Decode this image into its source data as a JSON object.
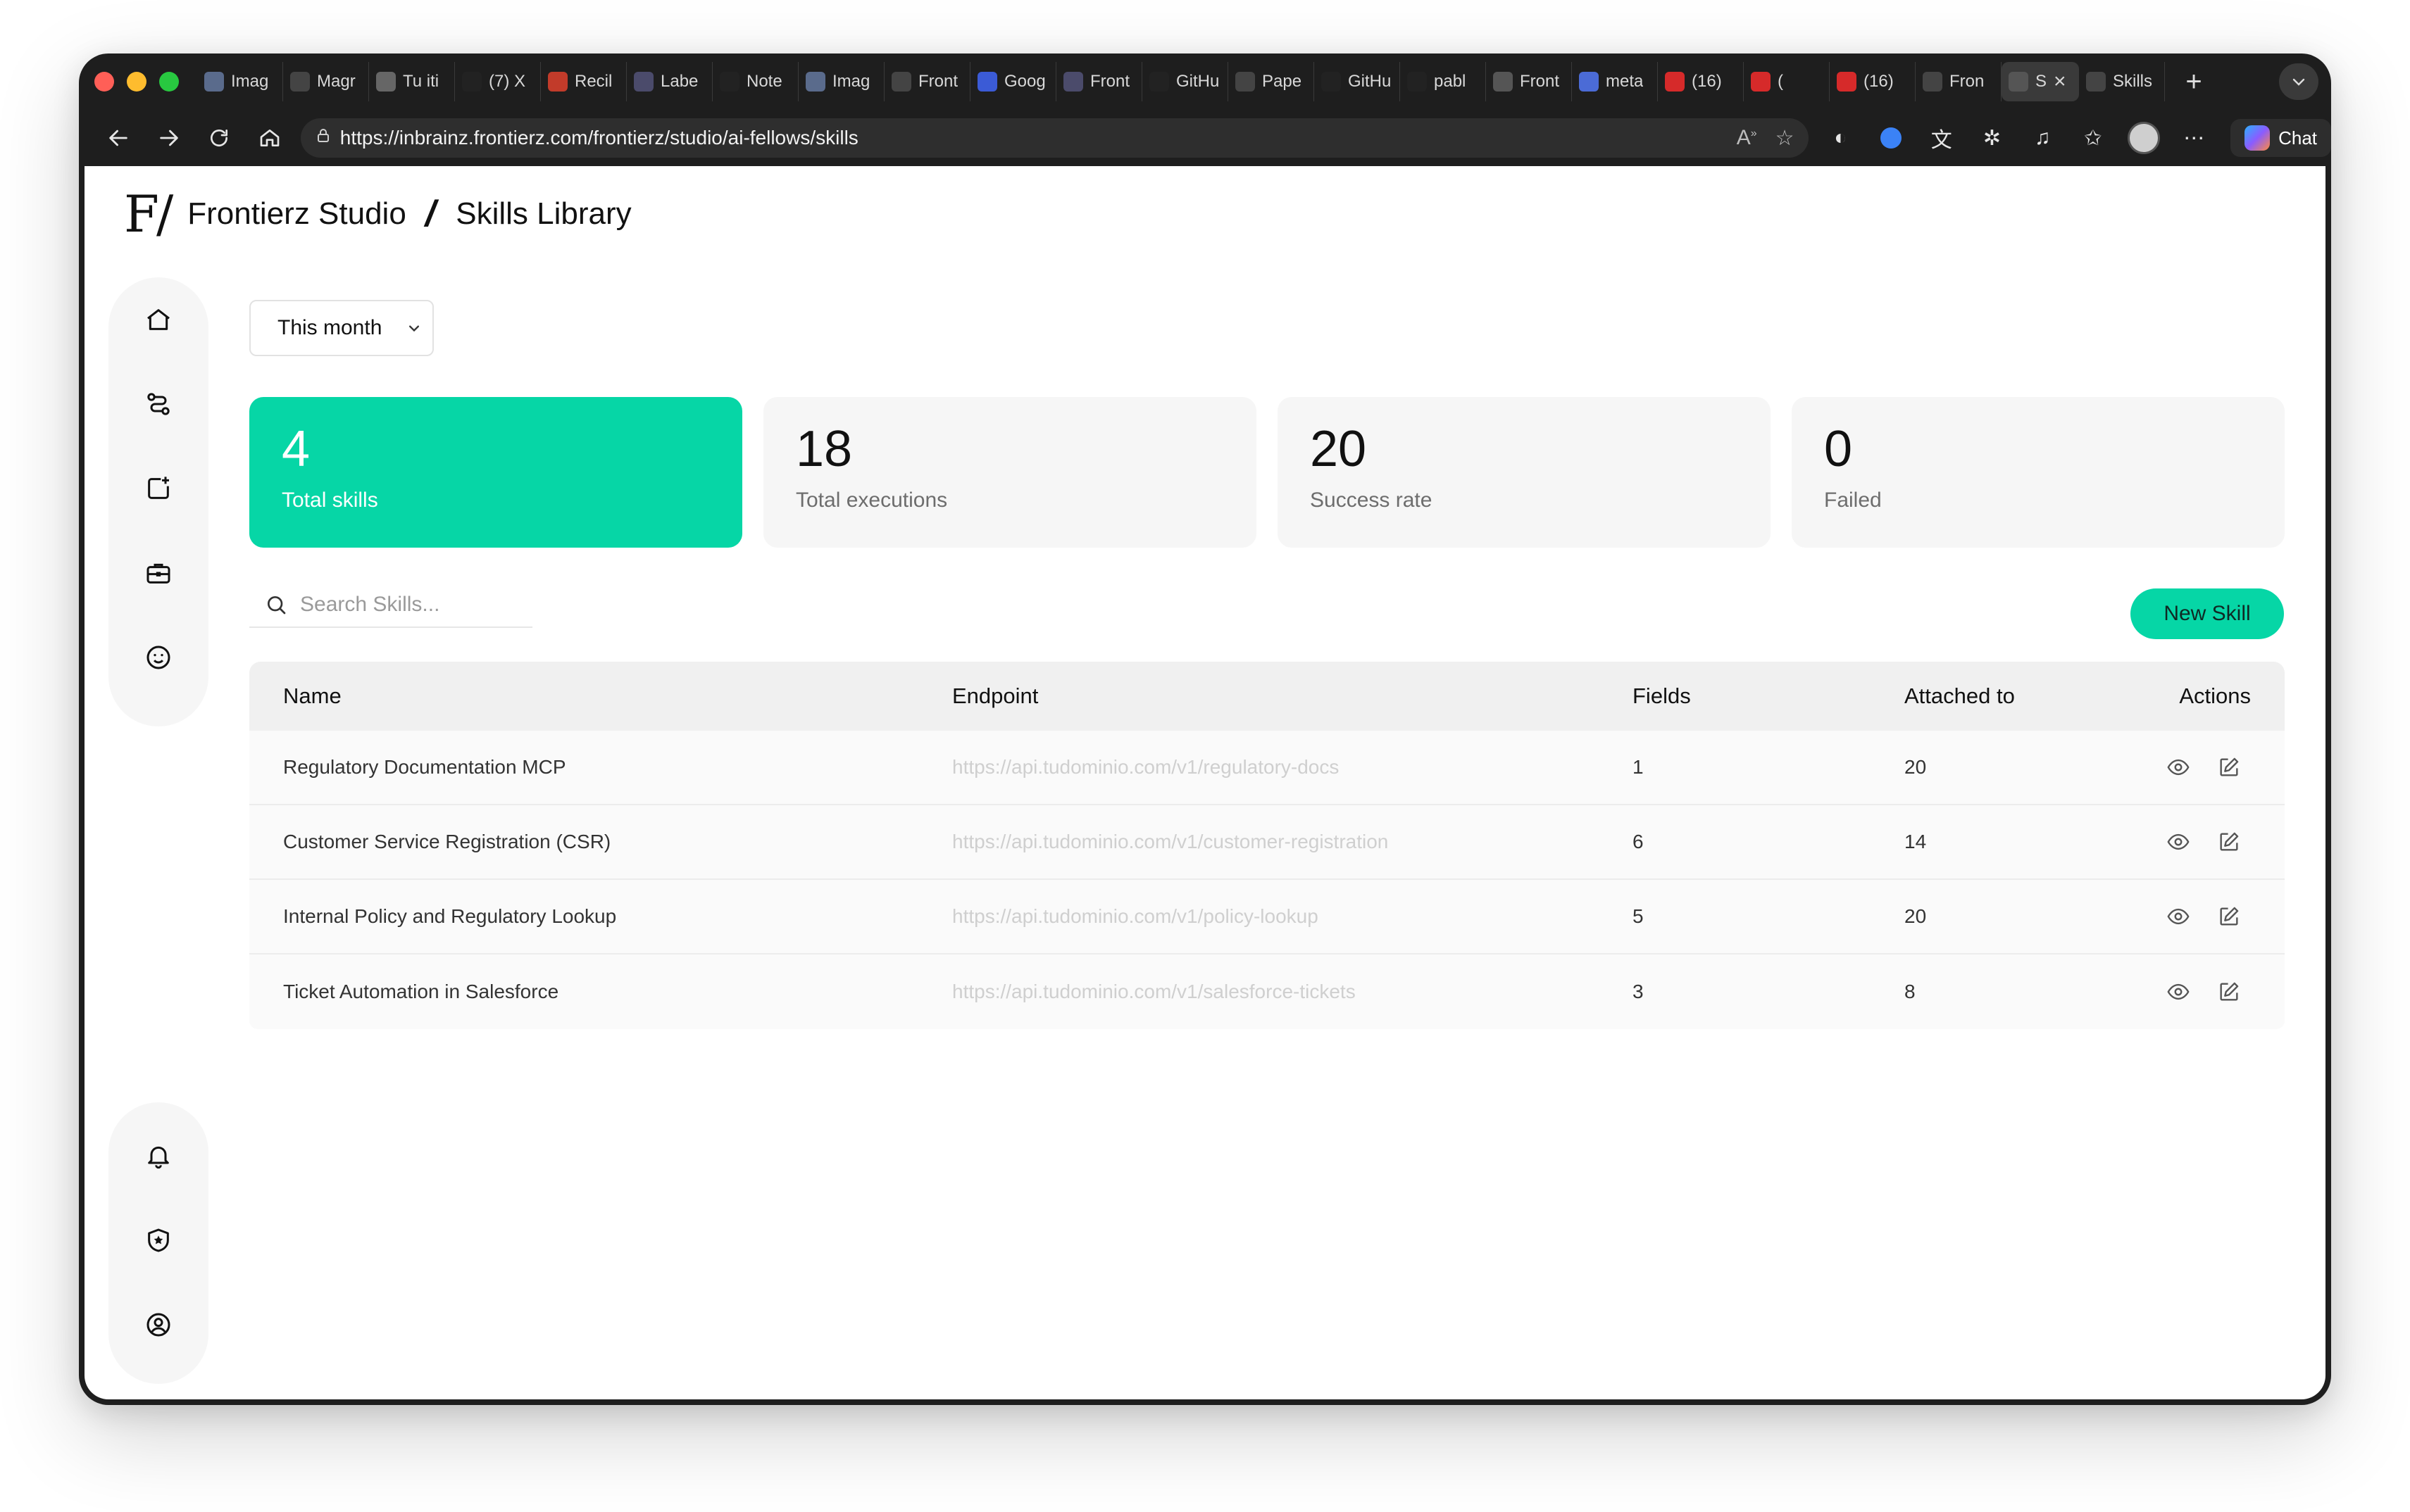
{
  "browser": {
    "tabs": [
      {
        "label": "Imag",
        "icon": "doc-icon",
        "color": "#5a6b8c"
      },
      {
        "label": "Magr",
        "icon": "triangle-icon",
        "color": "#444"
      },
      {
        "label": "Tu iti",
        "icon": "fz-icon",
        "color": "#666"
      },
      {
        "label": "(7) X",
        "icon": "x-icon",
        "color": "#222"
      },
      {
        "label": "Recil",
        "icon": "gmail-icon",
        "color": "#c23b2a"
      },
      {
        "label": "Labe",
        "icon": "puzzle-icon",
        "color": "#4b4b6b"
      },
      {
        "label": "Note",
        "icon": "notion-icon",
        "color": "#222"
      },
      {
        "label": "Imag",
        "icon": "doc-icon",
        "color": "#5a6b8c"
      },
      {
        "label": "Front",
        "icon": "fz-icon",
        "color": "#444"
      },
      {
        "label": "Goog",
        "icon": "gemini-icon",
        "color": "#3b5bd6"
      },
      {
        "label": "Front",
        "icon": "puzzle-icon",
        "color": "#4b4b6b"
      },
      {
        "label": "GitHu",
        "icon": "github-icon",
        "color": "#222"
      },
      {
        "label": "Pape",
        "icon": "pin-icon",
        "color": "#444"
      },
      {
        "label": "GitHu",
        "icon": "github-icon",
        "color": "#222"
      },
      {
        "label": "pabl",
        "icon": "github-icon",
        "color": "#222"
      },
      {
        "label": "Front",
        "icon": "fz-icon",
        "color": "#555"
      },
      {
        "label": "meta",
        "icon": "chart-icon",
        "color": "#4b6bd6"
      },
      {
        "label": "(16)",
        "icon": "youtube-icon",
        "color": "#d62a2a"
      },
      {
        "label": "(",
        "icon": "youtube-icon",
        "color": "#d62a2a"
      },
      {
        "label": "(16)",
        "icon": "youtube-icon",
        "color": "#d62a2a"
      },
      {
        "label": "Fron",
        "icon": "fz-icon",
        "color": "#444"
      },
      {
        "label": "S",
        "icon": "fz-icon",
        "color": "#555"
      },
      {
        "label": "Skills",
        "icon": "fz-icon",
        "color": "#444"
      }
    ],
    "url": "https://inbrainz.frontierz.com/frontierz/studio/ai-fellows/skills",
    "chat_label": "Chat"
  },
  "header": {
    "logo": "F/",
    "brand": "Frontierz Studio",
    "title": "Skills Library"
  },
  "filter": {
    "selected": "This month"
  },
  "stats": [
    {
      "value": "4",
      "label": "Total skills"
    },
    {
      "value": "18",
      "label": "Total executions"
    },
    {
      "value": "20",
      "label": "Success rate"
    },
    {
      "value": "0",
      "label": "Failed"
    }
  ],
  "search": {
    "placeholder": "Search Skills..."
  },
  "new_skill_label": "New Skill",
  "table": {
    "headers": [
      "Name",
      "Endpoint",
      "Fields",
      "Attached to",
      "Actions"
    ],
    "rows": [
      {
        "name": "Regulatory Documentation MCP",
        "endpoint": "https://api.tudominio.com/v1/regulatory-docs",
        "fields": "1",
        "attached": "20"
      },
      {
        "name": "Customer Service Registration (CSR)",
        "endpoint": "https://api.tudominio.com/v1/customer-registration",
        "fields": "6",
        "attached": "14"
      },
      {
        "name": "Internal Policy and Regulatory Lookup",
        "endpoint": "https://api.tudominio.com/v1/policy-lookup",
        "fields": "5",
        "attached": "20"
      },
      {
        "name": "Ticket Automation in Salesforce",
        "endpoint": "https://api.tudominio.com/v1/salesforce-tickets",
        "fields": "3",
        "attached": "8"
      }
    ]
  },
  "colors": {
    "accent": "#06d6a6",
    "stat_bg": "#f6f6f6"
  }
}
